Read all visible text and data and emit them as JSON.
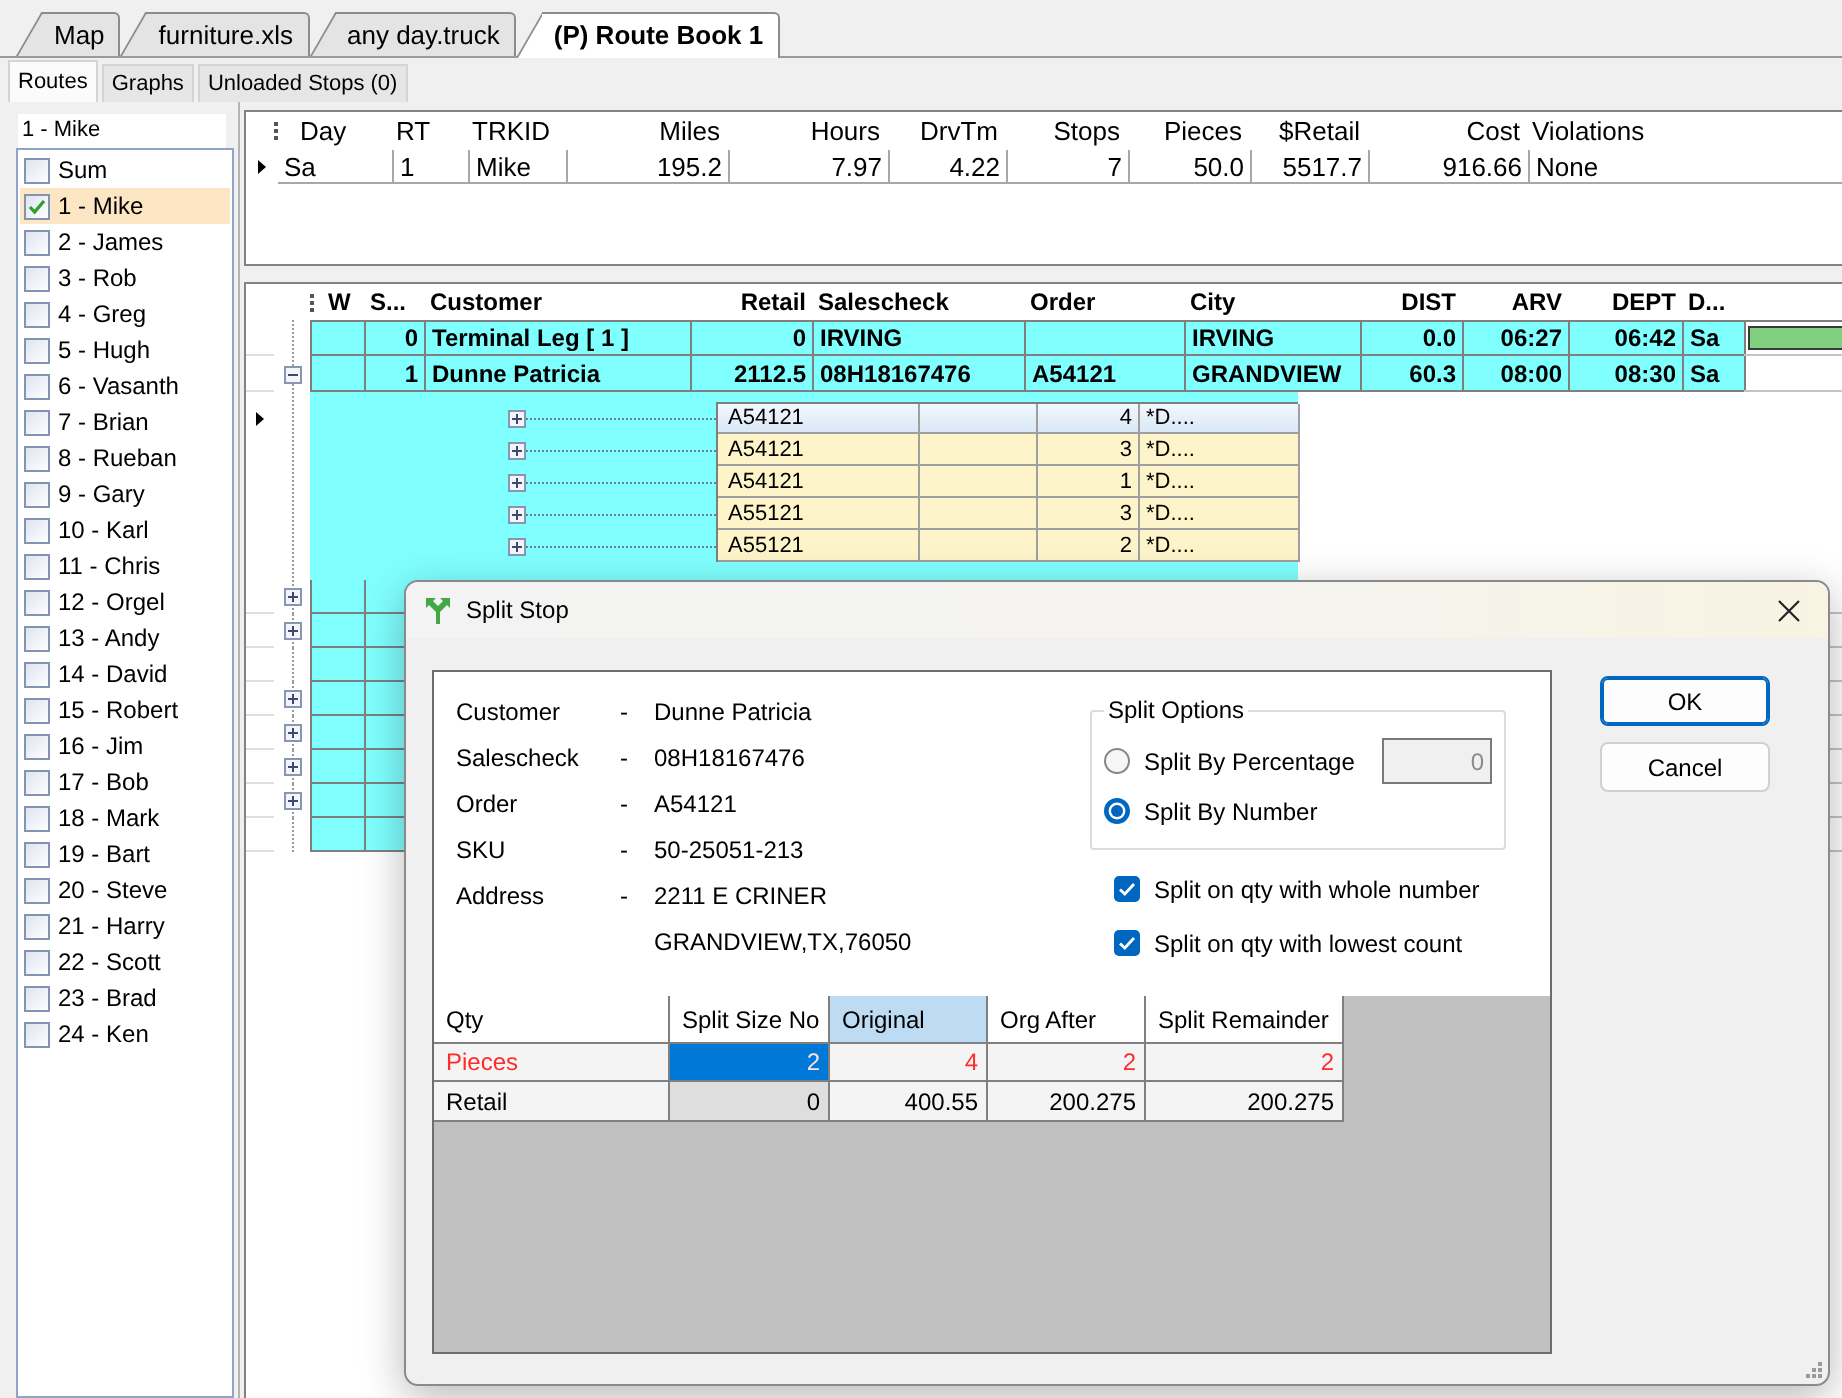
{
  "document_tabs": [
    {
      "label": "Map",
      "selected": false
    },
    {
      "label": "furniture.xls",
      "selected": false
    },
    {
      "label": "any day.truck",
      "selected": false
    },
    {
      "label": "(P) Route Book 1",
      "selected": true
    }
  ],
  "view_tabs": [
    {
      "label": "Routes",
      "selected": true
    },
    {
      "label": "Graphs",
      "selected": false
    },
    {
      "label": "Unloaded Stops (0)",
      "selected": false
    }
  ],
  "route_list": {
    "current": "1 - Mike",
    "items": [
      {
        "label": "Sum",
        "checked": false,
        "selected": false
      },
      {
        "label": "1 - Mike",
        "checked": true,
        "selected": true
      },
      {
        "label": "2 - James",
        "checked": false,
        "selected": false
      },
      {
        "label": "3 - Rob",
        "checked": false,
        "selected": false
      },
      {
        "label": "4 - Greg",
        "checked": false,
        "selected": false
      },
      {
        "label": "5 - Hugh",
        "checked": false,
        "selected": false
      },
      {
        "label": "6 - Vasanth",
        "checked": false,
        "selected": false
      },
      {
        "label": "7 - Brian",
        "checked": false,
        "selected": false
      },
      {
        "label": "8 - Rueban",
        "checked": false,
        "selected": false
      },
      {
        "label": "9 - Gary",
        "checked": false,
        "selected": false
      },
      {
        "label": "10 - Karl",
        "checked": false,
        "selected": false
      },
      {
        "label": "11 - Chris",
        "checked": false,
        "selected": false
      },
      {
        "label": "12 - Orgel",
        "checked": false,
        "selected": false
      },
      {
        "label": "13 - Andy",
        "checked": false,
        "selected": false
      },
      {
        "label": "14 - David",
        "checked": false,
        "selected": false
      },
      {
        "label": "15 - Robert",
        "checked": false,
        "selected": false
      },
      {
        "label": "16 - Jim",
        "checked": false,
        "selected": false
      },
      {
        "label": "17 - Bob",
        "checked": false,
        "selected": false
      },
      {
        "label": "18 - Mark",
        "checked": false,
        "selected": false
      },
      {
        "label": "19 - Bart",
        "checked": false,
        "selected": false
      },
      {
        "label": "20 - Steve",
        "checked": false,
        "selected": false
      },
      {
        "label": "21 - Harry",
        "checked": false,
        "selected": false
      },
      {
        "label": "22 - Scott",
        "checked": false,
        "selected": false
      },
      {
        "label": "23 - Brad",
        "checked": false,
        "selected": false
      },
      {
        "label": "24 - Ken",
        "checked": false,
        "selected": false
      }
    ]
  },
  "route_summary": {
    "columns": [
      {
        "label": "Day",
        "kind": "text"
      },
      {
        "label": "RT",
        "kind": "text"
      },
      {
        "label": "TRKID",
        "kind": "text"
      },
      {
        "label": "Miles",
        "kind": "number"
      },
      {
        "label": "Hours",
        "kind": "number"
      },
      {
        "label": "DrvTm",
        "kind": "number"
      },
      {
        "label": "Stops",
        "kind": "number"
      },
      {
        "label": "Pieces",
        "kind": "number"
      },
      {
        "label": "$Retail",
        "kind": "number"
      },
      {
        "label": "Cost",
        "kind": "number"
      },
      {
        "label": "Violations",
        "kind": "text"
      }
    ],
    "rows": [
      {
        "current": true,
        "cells": [
          "Sa",
          "1",
          "Mike",
          "195.2",
          "7.97",
          "4.22",
          "7",
          "50.0",
          "5517.7",
          "916.66",
          "None"
        ]
      }
    ]
  },
  "stops": {
    "columns": [
      {
        "label": "W",
        "kind": "text"
      },
      {
        "label": "S...",
        "kind": "number"
      },
      {
        "label": "Customer",
        "kind": "text"
      },
      {
        "label": "Retail",
        "kind": "number"
      },
      {
        "label": "Salescheck",
        "kind": "text"
      },
      {
        "label": "Order",
        "kind": "text"
      },
      {
        "label": "City",
        "kind": "text"
      },
      {
        "label": "DIST",
        "kind": "number"
      },
      {
        "label": "ARV",
        "kind": "number"
      },
      {
        "label": "DEPT",
        "kind": "number"
      },
      {
        "label": "D...",
        "kind": "text"
      }
    ],
    "rows": [
      {
        "expandable": false,
        "bar": true,
        "cells": [
          null,
          "0",
          "Terminal Leg [ 1 ]",
          "0",
          "IRVING",
          null,
          "IRVING",
          "0.0",
          "06:27",
          "06:42",
          "Sa"
        ]
      },
      {
        "expandable": true,
        "expanded": true,
        "bar": false,
        "cells": [
          null,
          "1",
          "Dunne Patricia",
          "2112.5",
          "08H18167476",
          "A54121",
          "GRANDVIEW",
          "60.3",
          "08:00",
          "08:30",
          "Sa"
        ],
        "details": [
          {
            "order": "A54121",
            "qty": "4",
            "note": "*D....",
            "selected": true,
            "expanded": false
          },
          {
            "order": "A54121",
            "qty": "3",
            "note": "*D....",
            "selected": false,
            "expanded": false
          },
          {
            "order": "A54121",
            "qty": "1",
            "note": "*D....",
            "selected": false,
            "expanded": false
          },
          {
            "order": "A55121",
            "qty": "3",
            "note": "*D....",
            "selected": false,
            "expanded": false
          },
          {
            "order": "A55121",
            "qty": "2",
            "note": "*D....",
            "selected": false,
            "expanded": false
          }
        ]
      },
      {
        "expandable": true,
        "expanded": false
      },
      {
        "expandable": true,
        "expanded": false
      },
      {
        "expandable": false
      },
      {
        "expandable": true,
        "expanded": false
      },
      {
        "expandable": true,
        "expanded": false
      },
      {
        "expandable": true,
        "expanded": false
      },
      {
        "expandable": true,
        "expanded": false
      },
      {
        "expandable": false
      }
    ]
  },
  "dialog": {
    "title": "Split Stop",
    "info": [
      {
        "label": "Customer",
        "separator": "-",
        "lines": [
          "Dunne Patricia"
        ]
      },
      {
        "label": "Salescheck",
        "separator": "-",
        "lines": [
          "08H18167476"
        ]
      },
      {
        "label": "Order",
        "separator": "-",
        "lines": [
          "A54121"
        ]
      },
      {
        "label": "SKU",
        "separator": "-",
        "lines": [
          "50-25051-213"
        ]
      },
      {
        "label": "Address",
        "separator": "-",
        "lines": [
          "2211 E CRINER",
          "GRANDVIEW,TX,76050"
        ]
      }
    ],
    "split_options": {
      "title": "Split Options",
      "options": [
        {
          "label": "Split By Percentage",
          "selected": false
        },
        {
          "label": "Split By Number",
          "selected": true
        }
      ],
      "percentage": {
        "value": "0",
        "disabled": true
      }
    },
    "checkboxes": [
      {
        "label": "Split on qty with whole number",
        "checked": true
      },
      {
        "label": "Split on qty with lowest count",
        "checked": true
      }
    ],
    "buttons": [
      {
        "label": "OK",
        "default": true
      },
      {
        "label": "Cancel",
        "default": false
      }
    ],
    "split_table": {
      "columns": [
        {
          "label": "Qty",
          "selected": false
        },
        {
          "label": "Split Size No",
          "selected": false
        },
        {
          "label": "Original",
          "selected": true
        },
        {
          "label": "Org After",
          "selected": false
        },
        {
          "label": "Split Remainder",
          "selected": false
        }
      ],
      "rows": [
        {
          "color": "#ff2a2a",
          "cells": [
            {
              "text": "Pieces",
              "selected": false,
              "disabled": false
            },
            {
              "text": "2",
              "selected": true,
              "disabled": false
            },
            {
              "text": "4",
              "selected": false,
              "disabled": false
            },
            {
              "text": "2",
              "selected": false,
              "disabled": false
            },
            {
              "text": "2",
              "selected": false,
              "disabled": false
            }
          ]
        },
        {
          "color": "#000000",
          "cells": [
            {
              "text": "Retail",
              "selected": false,
              "disabled": false
            },
            {
              "text": "0",
              "selected": false,
              "disabled": true
            },
            {
              "text": "400.55",
              "selected": false,
              "disabled": false
            },
            {
              "text": "200.275",
              "selected": false,
              "disabled": false
            },
            {
              "text": "200.275",
              "selected": false,
              "disabled": false
            }
          ]
        }
      ]
    }
  }
}
